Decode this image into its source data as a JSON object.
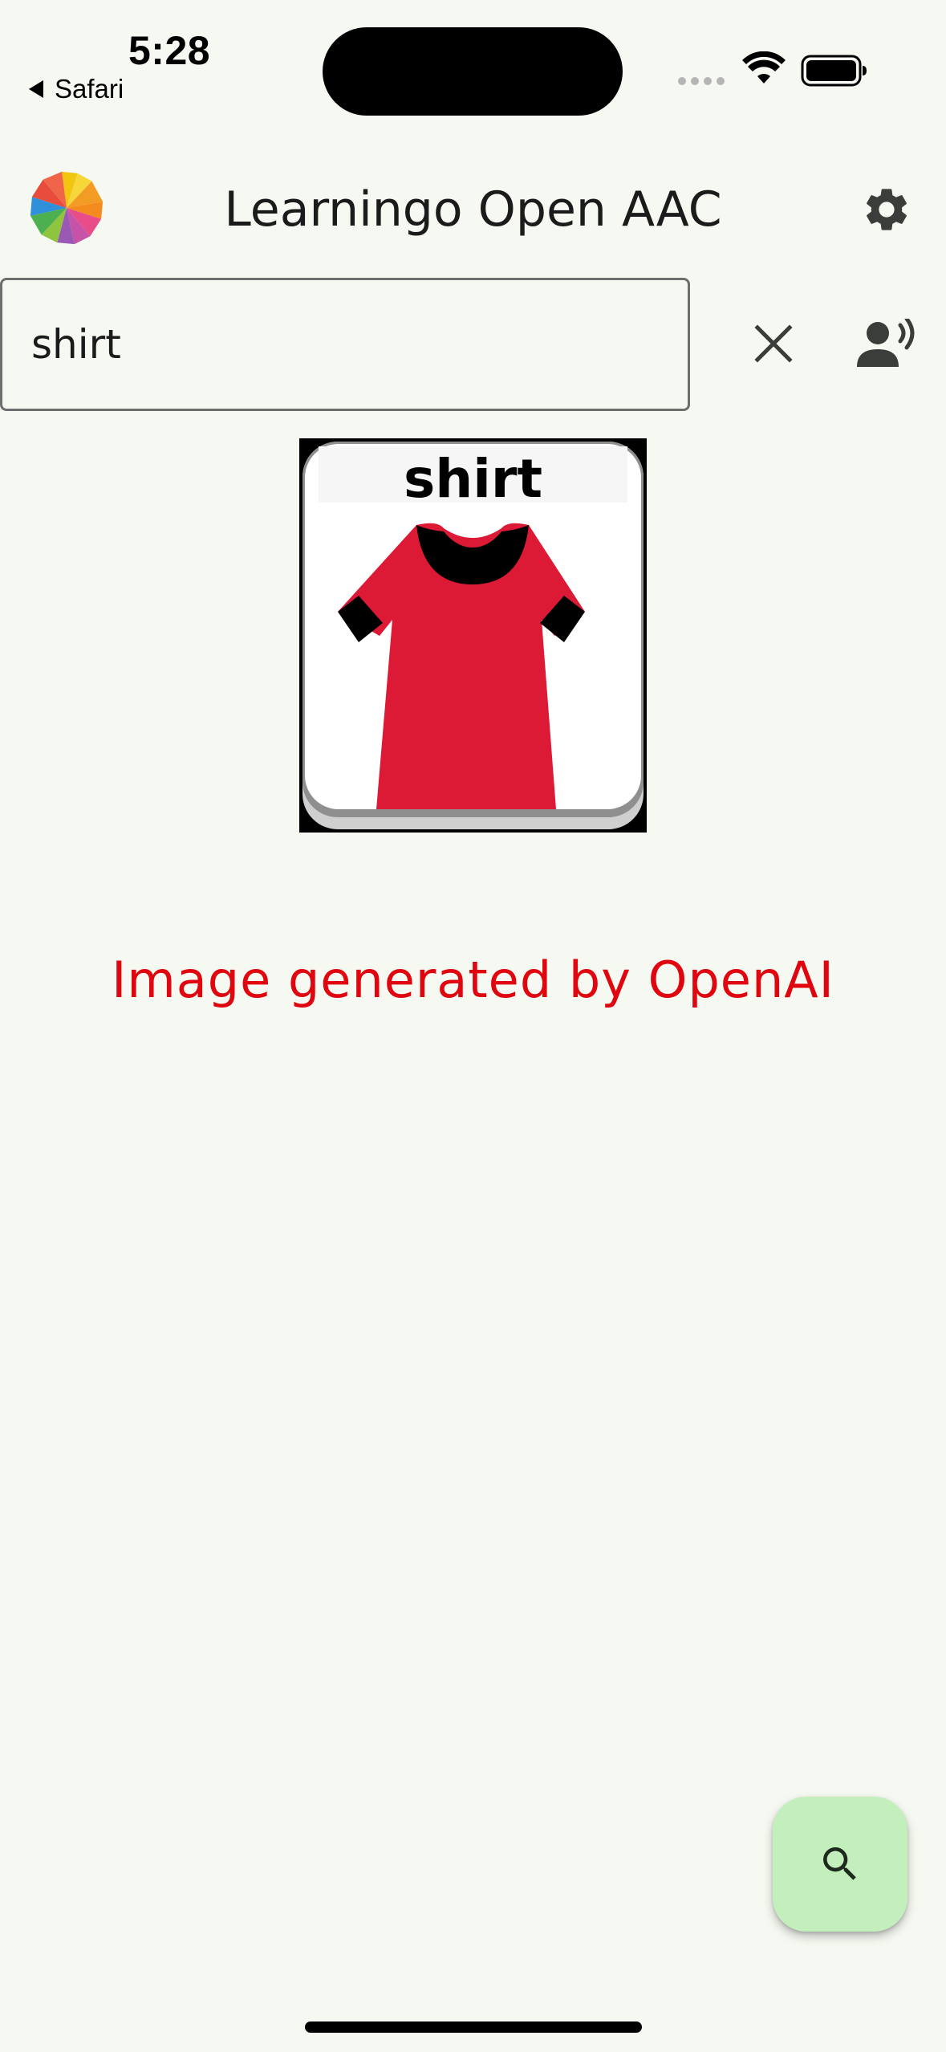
{
  "status_bar": {
    "time": "5:28",
    "back_label": "Safari"
  },
  "app_bar": {
    "title": "Learningo Open AAC",
    "logo_icon": "pinwheel-logo-icon",
    "settings_icon": "gear-icon"
  },
  "search": {
    "value": "shirt",
    "clear_icon": "close-icon",
    "speak_icon": "speaking-person-icon"
  },
  "symbol": {
    "label": "shirt",
    "image_icon": "red-t-shirt-icon",
    "colors": {
      "shirt": "#dc1a36",
      "trim": "#000000"
    }
  },
  "attribution": {
    "text": "Image generated by OpenAI",
    "color": "#e0060f"
  },
  "fab": {
    "icon": "search-icon",
    "color": "#c3efbd"
  }
}
